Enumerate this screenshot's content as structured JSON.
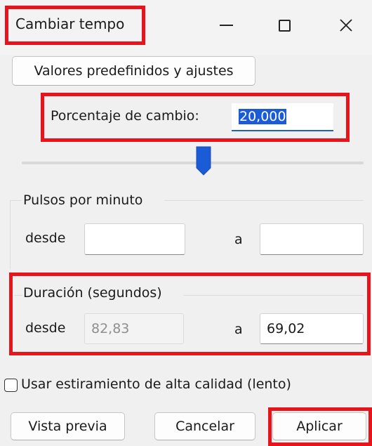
{
  "window": {
    "title": "Cambiar tempo",
    "minimize_glyph": "—",
    "close_glyph": "✕"
  },
  "presets": {
    "label": "Valores predefinidos y ajustes"
  },
  "percent_change": {
    "label": "Porcentaje de cambio:",
    "value": "20,000"
  },
  "slider": {
    "level_fraction": 0.51
  },
  "bpm": {
    "group_label": "Pulsos por minuto",
    "from_label": "desde",
    "from_value": "",
    "to_label": "a",
    "to_value": ""
  },
  "duration": {
    "group_label": "Duración (segundos)",
    "from_label": "desde",
    "from_value": "82,83",
    "to_label": "a",
    "to_value": "69,02"
  },
  "high_quality": {
    "label": "Usar estiramiento de alta calidad (lento)",
    "checked": false
  },
  "buttons": {
    "preview": "Vista previa",
    "cancel": "Cancelar",
    "apply": "Aplicar"
  },
  "colors": {
    "accent": "#1b5bd6",
    "annotation": "#e8141b",
    "background": "#f0f0f0"
  }
}
